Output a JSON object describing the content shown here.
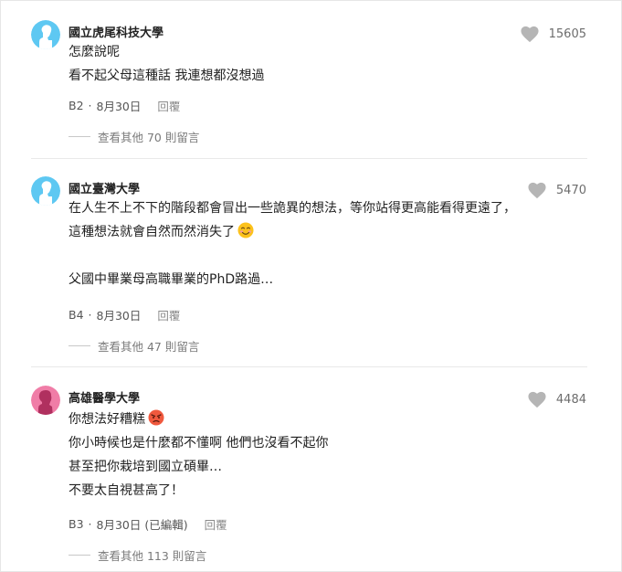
{
  "comments": [
    {
      "author": "國立虎尾科技大學",
      "likes": "15605",
      "lines": [
        "怎麼說呢",
        "看不起父母這種話 我連想都沒想過"
      ],
      "floor": "B2",
      "date": "8月30日",
      "reply": "回覆",
      "view_more": "查看其他 70 則留言",
      "avatar_color": "#5ec8f2",
      "avatar_gender": "male"
    },
    {
      "author": "國立臺灣大學",
      "likes": "5470",
      "lines": [
        "在人生不上不下的階段都會冒出一些詭異的想法，等你站得更高能看得更遠了，",
        "這種想法就會自然而然消失了",
        "",
        "父國中畢業母高職畢業的PhD路過…"
      ],
      "floor": "B4",
      "date": "8月30日",
      "reply": "回覆",
      "view_more": "查看其他 47 則留言",
      "avatar_color": "#5ec8f2",
      "avatar_gender": "male"
    },
    {
      "author": "高雄醫學大學",
      "likes": "4484",
      "lines": [
        "你想法好糟糕",
        "你小時候也是什麼都不懂啊 他們也沒看不起你",
        "甚至把你栽培到國立碩畢…",
        "不要太自視甚高了！"
      ],
      "floor": "B3",
      "date": "8月30日 (已編輯)",
      "reply": "回覆",
      "view_more": "查看其他 113 則留言",
      "avatar_color": "#f07da7",
      "avatar_gender": "female"
    }
  ],
  "separator": "·",
  "icons": {
    "like": "heart-icon",
    "smile_emoji": "smiling-face-emoji",
    "angry_emoji": "angry-face-emoji"
  },
  "colors": {
    "heart": "#b5b5b5",
    "text": "#222222",
    "meta": "#555555",
    "divider": "#e9e9e9"
  }
}
